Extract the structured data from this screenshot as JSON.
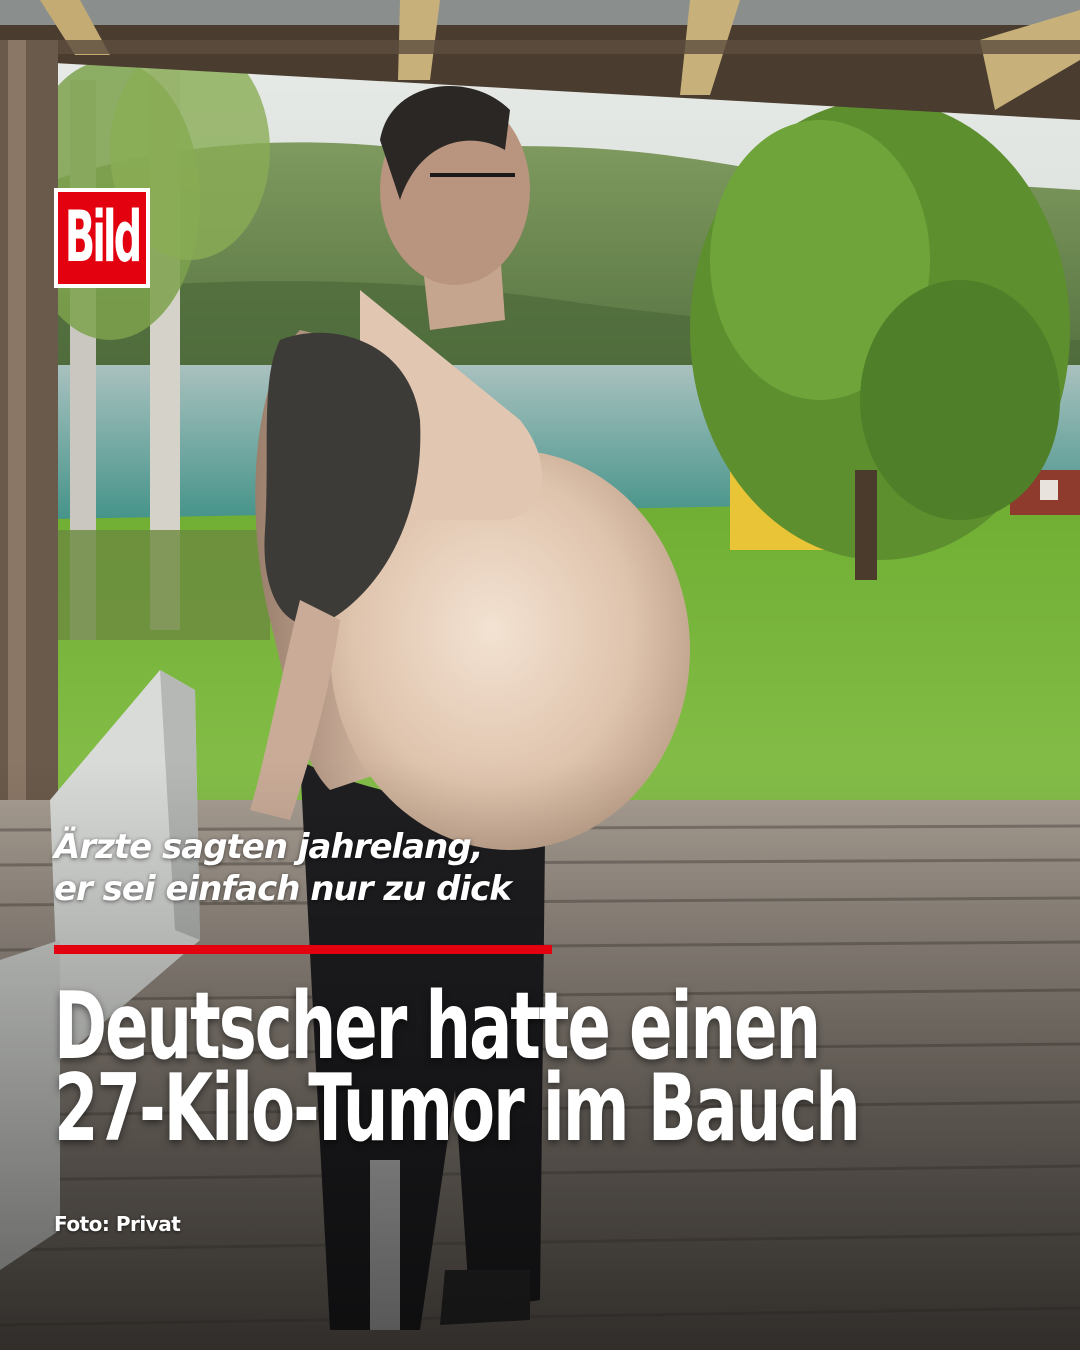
{
  "brand": {
    "logo_text": "Bild",
    "accent_color": "#e3000f"
  },
  "article": {
    "kicker_lines": [
      "Ärzte sagten jahrelang,",
      "er sei einfach nur zu dick"
    ],
    "headline_lines": [
      "Deutscher hatte einen",
      "27-Kilo-Tumor im Bauch"
    ],
    "photo_credit": "Foto: Privat"
  }
}
